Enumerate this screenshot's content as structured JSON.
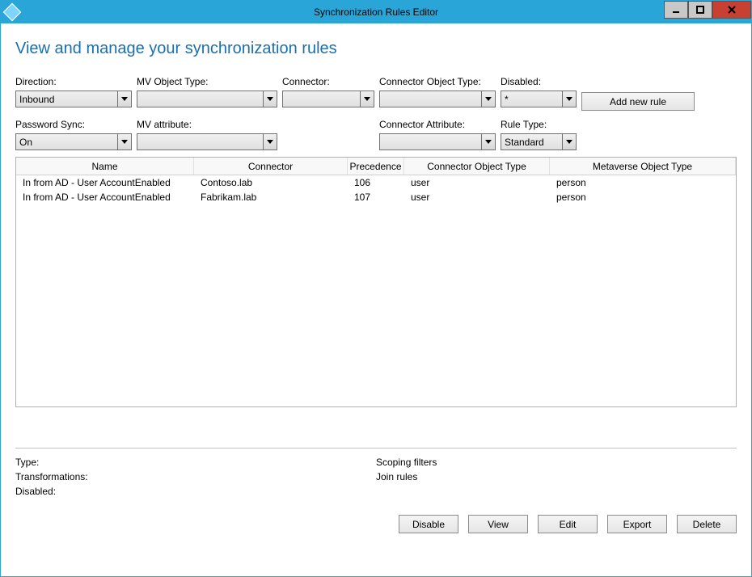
{
  "window": {
    "title": "Synchronization Rules Editor"
  },
  "page": {
    "heading": "View and manage your synchronization rules"
  },
  "filters": {
    "direction": {
      "label": "Direction:",
      "value": "Inbound"
    },
    "mv_object_type": {
      "label": "MV Object Type:",
      "value": ""
    },
    "connector": {
      "label": "Connector:",
      "value": ""
    },
    "connector_object_type": {
      "label": "Connector Object Type:",
      "value": ""
    },
    "disabled": {
      "label": "Disabled:",
      "value": "*"
    },
    "password_sync": {
      "label": "Password Sync:",
      "value": "On"
    },
    "mv_attribute": {
      "label": "MV attribute:",
      "value": ""
    },
    "connector_attribute": {
      "label": "Connector Attribute:",
      "value": ""
    },
    "rule_type": {
      "label": "Rule Type:",
      "value": "Standard"
    }
  },
  "buttons": {
    "add_new_rule": "Add new rule",
    "disable": "Disable",
    "view": "View",
    "edit": "Edit",
    "export": "Export",
    "delete": "Delete"
  },
  "grid": {
    "headers": {
      "name": "Name",
      "connector": "Connector",
      "precedence": "Precedence",
      "connector_object_type": "Connector Object Type",
      "metaverse_object_type": "Metaverse Object Type"
    },
    "rows": [
      {
        "name": "In from AD - User AccountEnabled",
        "connector": "Contoso.lab",
        "precedence": "106",
        "cot": "user",
        "mvot": "person"
      },
      {
        "name": "In from AD - User AccountEnabled",
        "connector": "Fabrikam.lab",
        "precedence": "107",
        "cot": "user",
        "mvot": "person"
      }
    ]
  },
  "details": {
    "left": {
      "type": "Type:",
      "transformations": "Transformations:",
      "disabled": "Disabled:"
    },
    "right": {
      "scoping": "Scoping filters",
      "join": "Join rules"
    }
  }
}
